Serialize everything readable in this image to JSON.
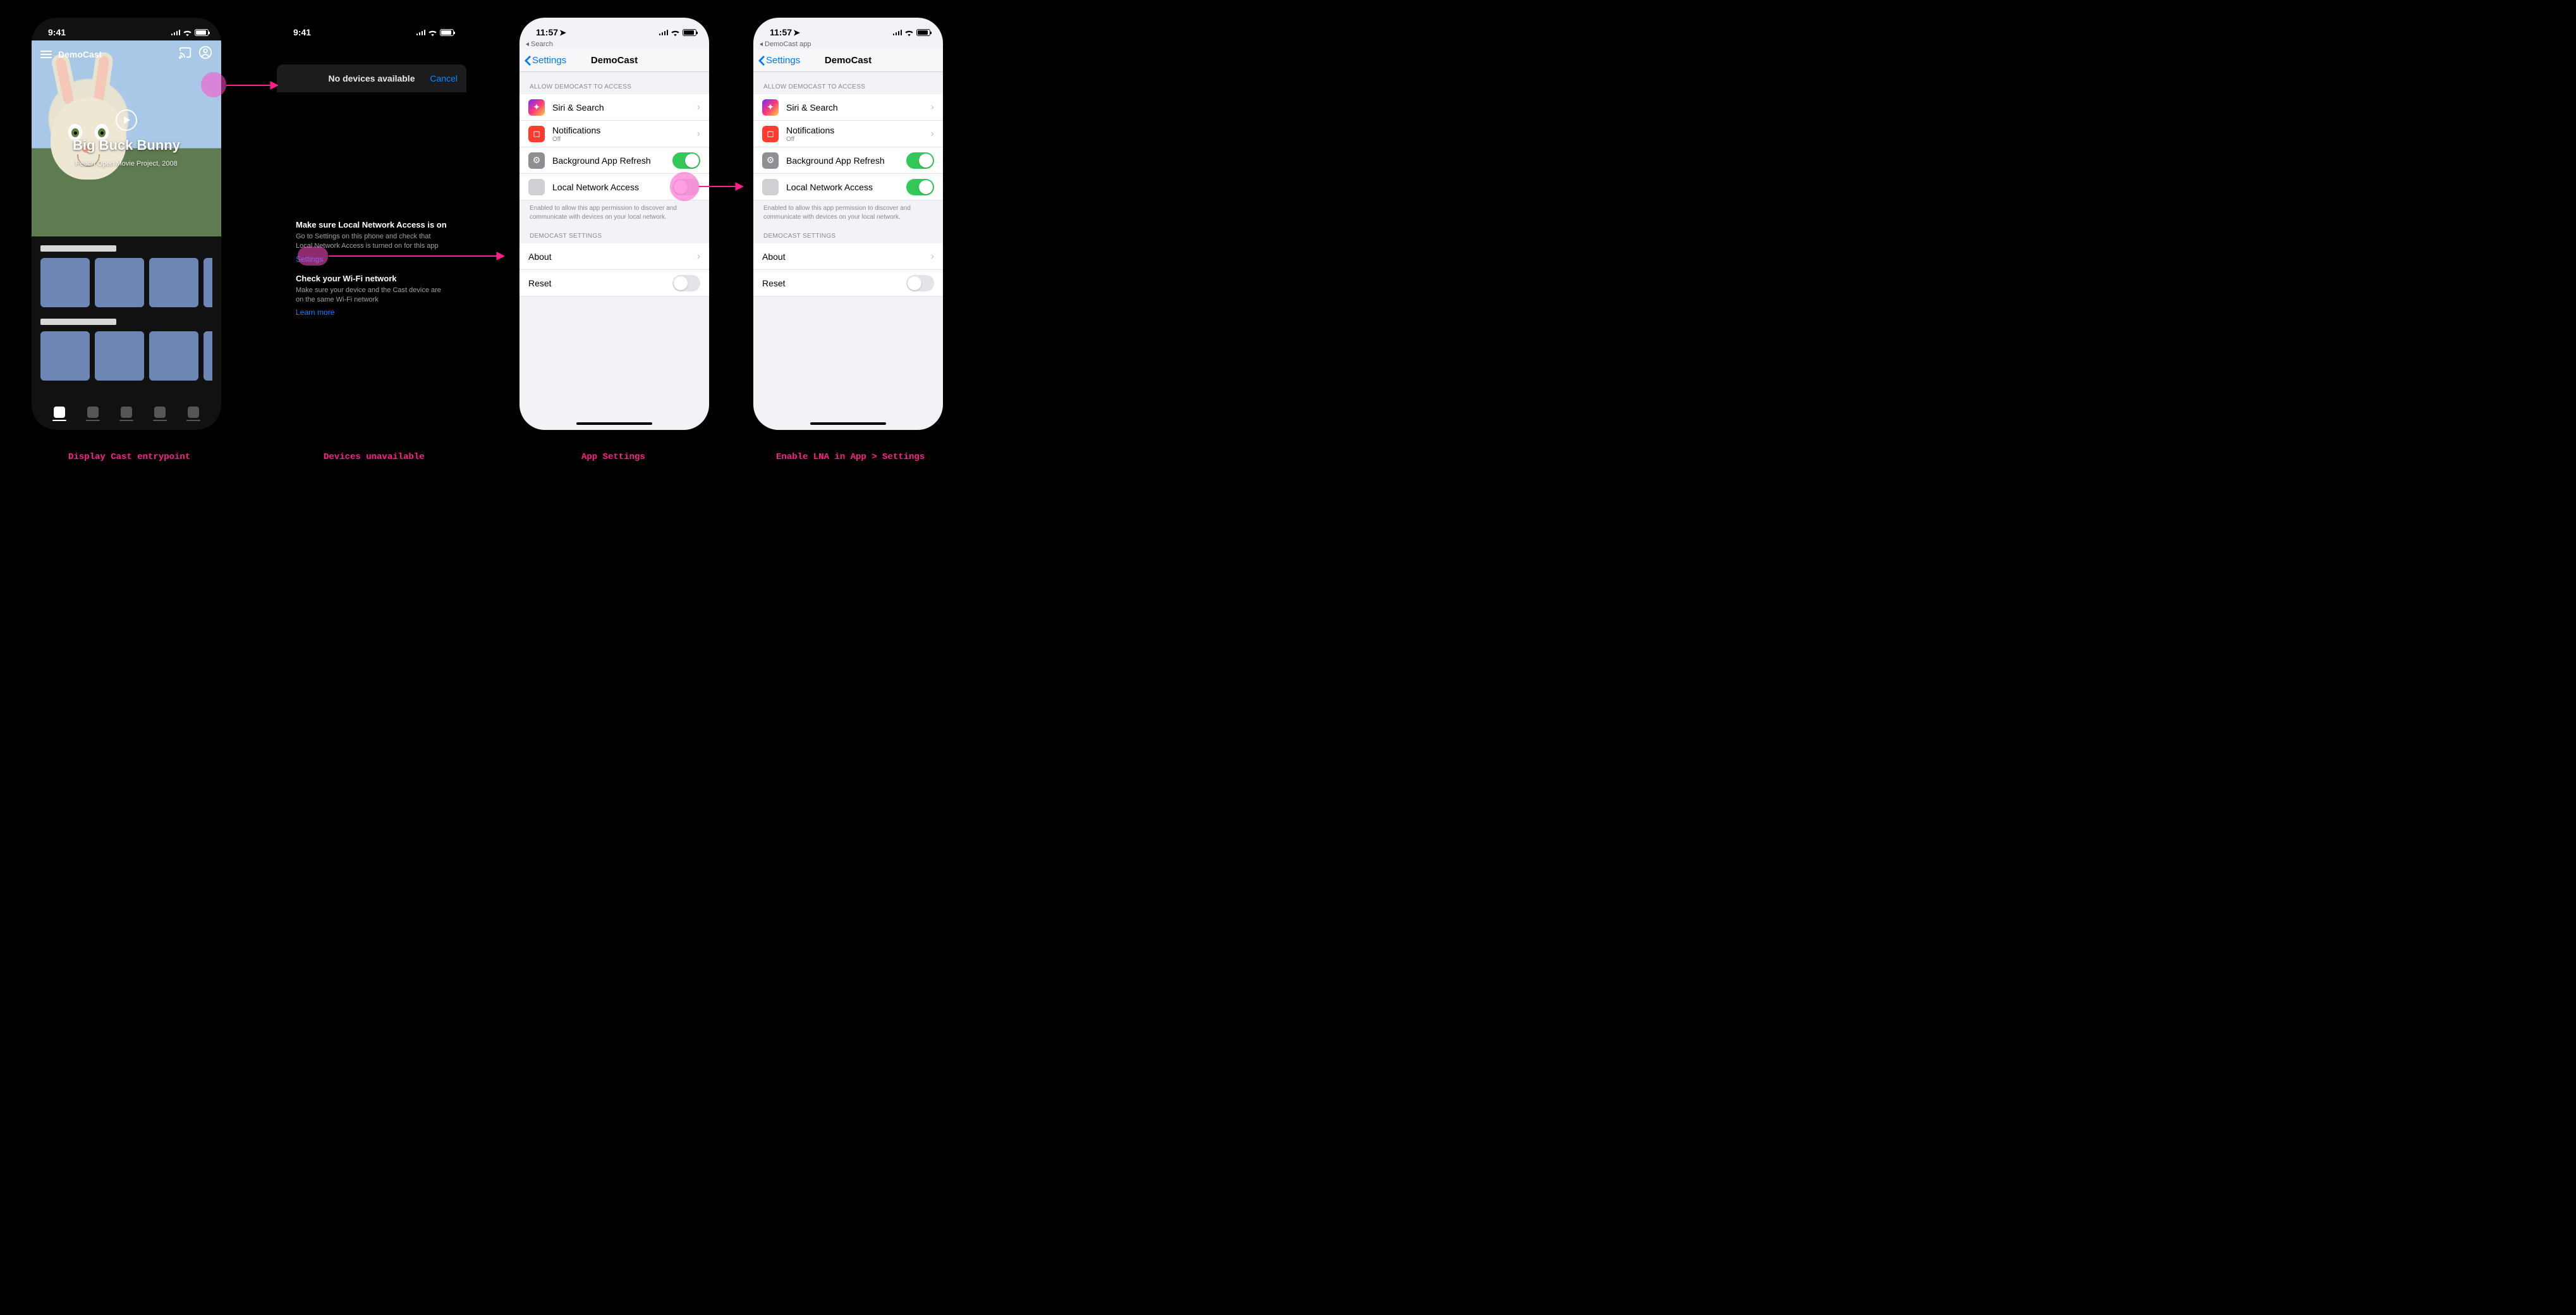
{
  "captions": {
    "c1": "Display Cast entrypoint",
    "c2": "Devices unavailable",
    "c3": "App Settings",
    "c4": "Enable LNA in App > Settings"
  },
  "phone1": {
    "time": "9:41",
    "app_name": "DemoCast",
    "hero_title": "Big Buck Bunny",
    "hero_subtitle": "Peach Open Movie Project, 2008"
  },
  "phone2": {
    "time": "9:41",
    "modal_title": "No devices available",
    "cancel": "Cancel",
    "tip1_title": "Make sure Local Network Access is on",
    "tip1_body": "Go to Settings on this phone and check that Local Network Access is turned on for this app",
    "tip1_link": "Settings",
    "tip2_title": "Check your Wi-Fi network",
    "tip2_body": "Make sure your device and the Cast device are on the same Wi-Fi network",
    "tip2_link": "Learn more"
  },
  "settings": {
    "time": "11:57",
    "breadcrumb_search": "Search",
    "breadcrumb_app": "DemoCast app",
    "back": "Settings",
    "title": "DemoCast",
    "group_access": "ALLOW DEMOCAST TO ACCESS",
    "siri": "Siri & Search",
    "notifications": "Notifications",
    "notifications_sub": "Off",
    "bg_refresh": "Background App Refresh",
    "lna": "Local Network Access",
    "lna_footer": "Enabled to allow this app permission to discover and communicate with devices on your local network.",
    "group_app": "DEMOCAST SETTINGS",
    "about": "About",
    "reset": "Reset"
  }
}
